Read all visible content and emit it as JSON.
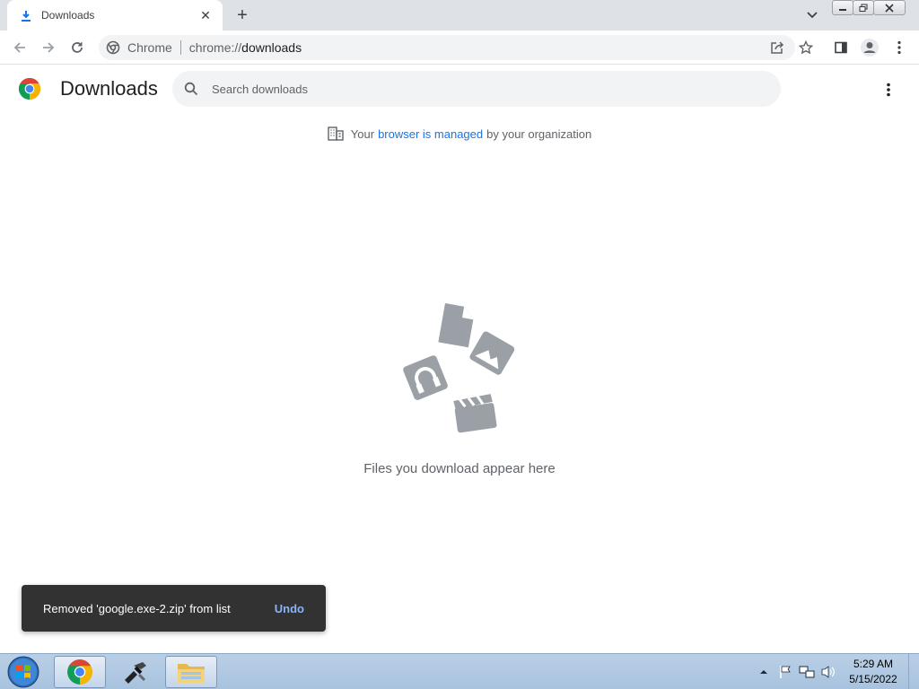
{
  "window": {
    "tab_title": "Downloads",
    "tab_close": "✕",
    "new_tab": "+"
  },
  "toolbar": {
    "site_chip": "Chrome",
    "url_scheme": "chrome://",
    "url_host": "downloads"
  },
  "page": {
    "title": "Downloads",
    "search_placeholder": "Search downloads",
    "managed_prefix": "Your",
    "managed_link": "browser is managed",
    "managed_suffix": "by your organization",
    "empty_message": "Files you download appear here"
  },
  "toast": {
    "message": "Removed 'google.exe-2.zip' from list",
    "action": "Undo"
  },
  "taskbar": {
    "time": "5:29 AM",
    "date": "5/15/2022"
  },
  "colors": {
    "accent": "#1a73e8",
    "toast_bg": "#323232",
    "undo": "#8ab4f8"
  }
}
